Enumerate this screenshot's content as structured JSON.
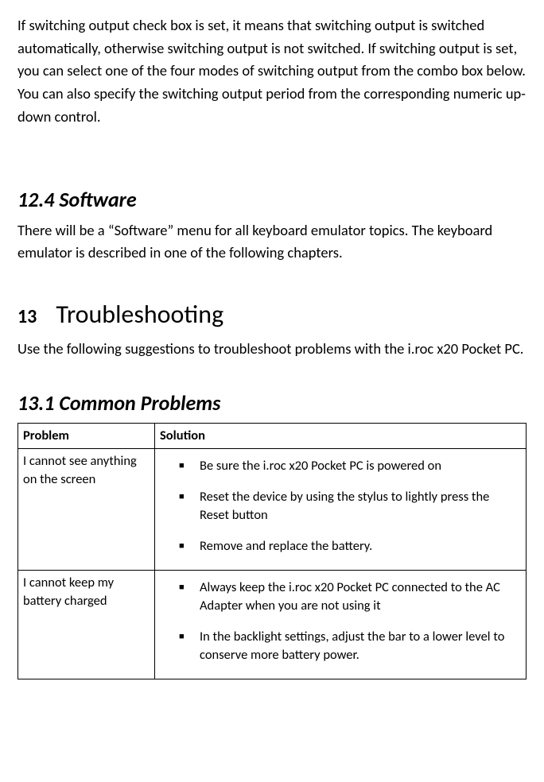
{
  "intro": "If switching output check box is set, it means that switching output is switched automatically, otherwise switching output is not switched. If switching output is set, you can select one of the four modes of switching output from the combo box below. You can also specify the switching output period from the corresponding numeric up-down control.",
  "s12_4": {
    "heading": "12.4  Software",
    "text": "There will be a “Software” menu for all keyboard emulator topics. The keyboard emulator is described in one of the following chapters."
  },
  "s13": {
    "num": "13",
    "title": "Troubleshooting",
    "text": "Use the following suggestions to troubleshoot problems with the i.roc x20 Pocket PC."
  },
  "s13_1": {
    "heading": "13.1  Common Problems",
    "table": {
      "headers": {
        "problem": "Problem",
        "solution": "Solution"
      },
      "rows": [
        {
          "problem": "I cannot see anything on the screen",
          "solutions": [
            "Be sure the i.roc x20 Pocket PC is powered on",
            "Reset the device by using the stylus to lightly press the Reset button",
            "Remove and replace the battery."
          ]
        },
        {
          "problem": "I cannot keep my battery charged",
          "solutions": [
            "Always keep the i.roc x20 Pocket PC connected to the AC Adapter when you are not using it",
            "In the backlight settings, adjust the bar to a lower level to conserve more battery power."
          ]
        }
      ]
    }
  }
}
